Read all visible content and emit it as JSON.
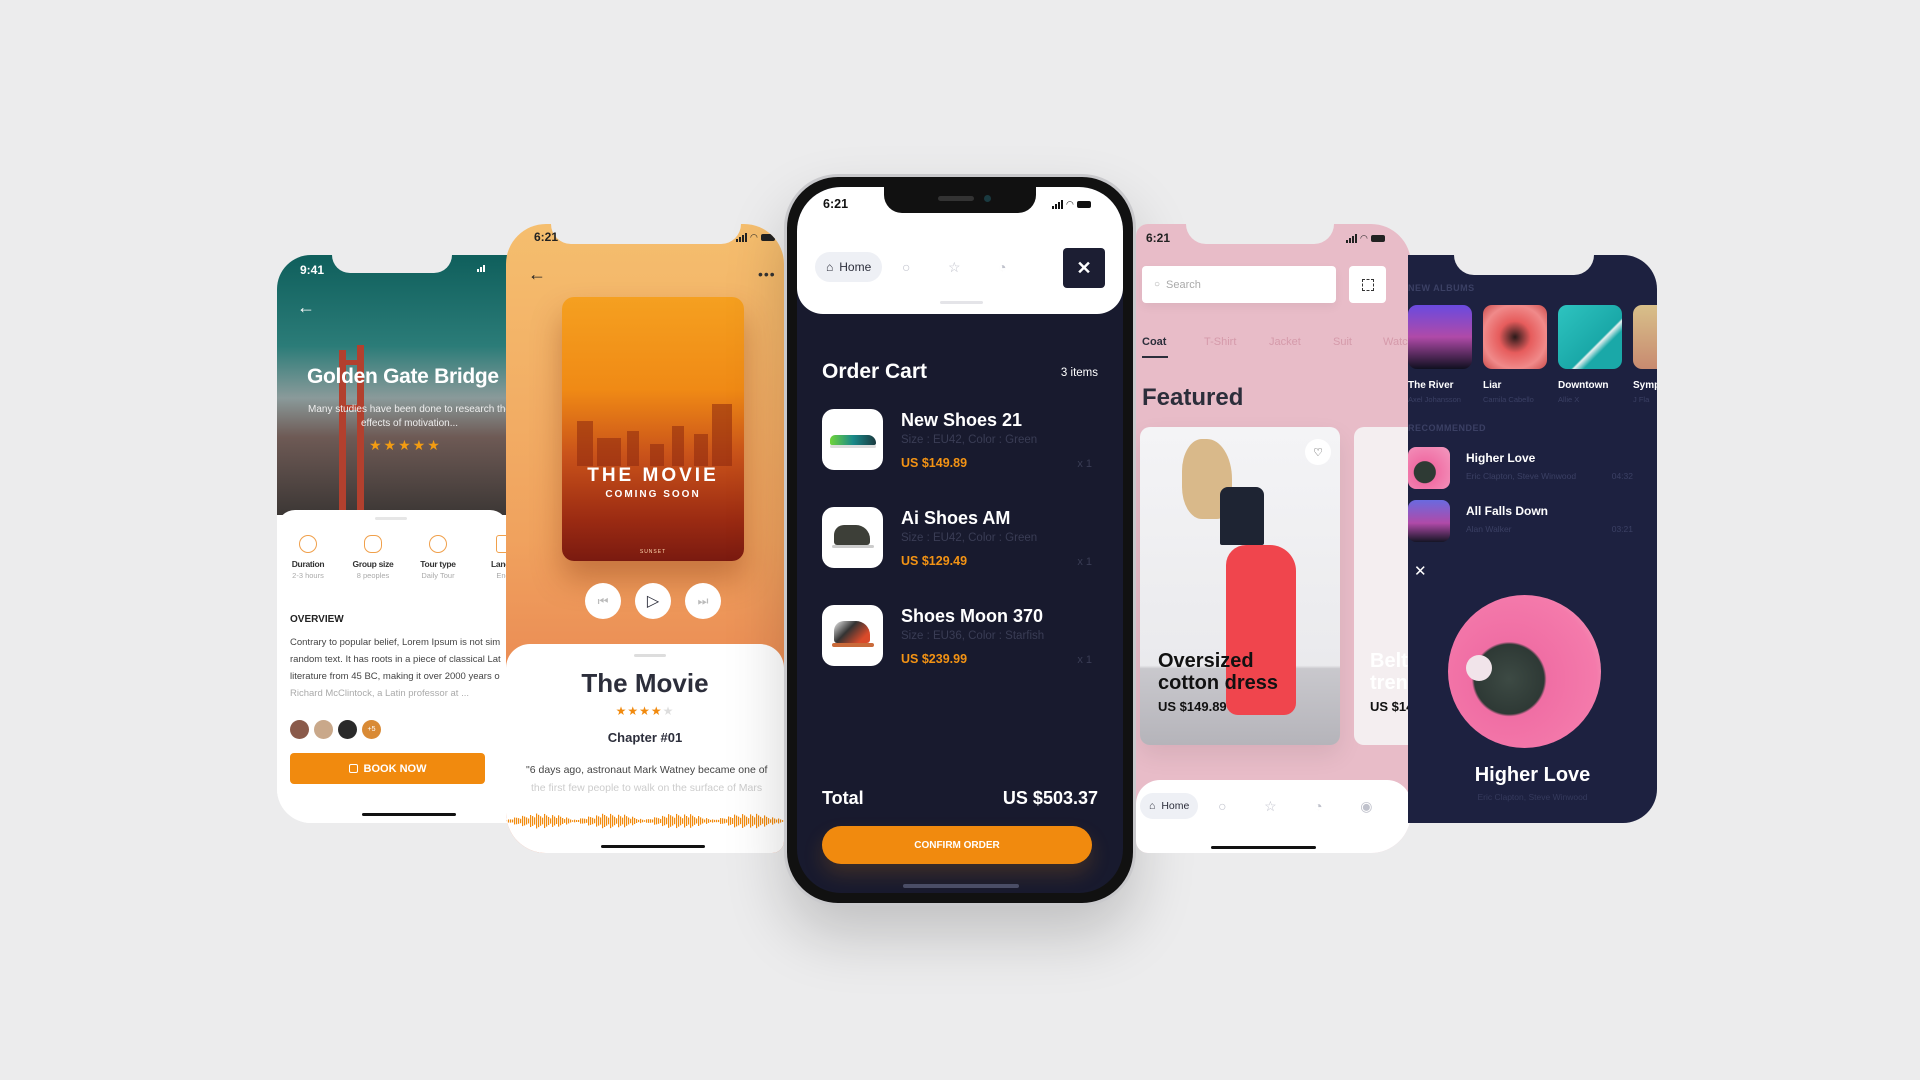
{
  "colors": {
    "background": "#ececed",
    "accent_orange": "#f18a0e",
    "dark_navy": "#181a2e",
    "music_navy": "#1d2140",
    "fashion_pink": "#e8bcc8"
  },
  "tour_app": {
    "status_time": "9:41",
    "back_icon": "arrow-left-icon",
    "title": "Golden Gate Bridge",
    "subtitle": "Many studies have been done to research the effects of motivation...",
    "rating_stars": 5,
    "stars_text": "★★★★★",
    "stats": [
      {
        "icon": "clock-icon",
        "label": "Duration",
        "value": "2-3 hours"
      },
      {
        "icon": "group-icon",
        "label": "Group size",
        "value": "8 peoples"
      },
      {
        "icon": "globe-icon",
        "label": "Tour type",
        "value": "Daily Tour"
      },
      {
        "icon": "language-icon",
        "label": "Langu",
        "value": "Eng"
      }
    ],
    "overview_heading": "OVERVIEW",
    "overview_lines": [
      "Contrary to popular belief, Lorem Ipsum is not sim",
      "random text. It has roots in a piece of classical Lat",
      "literature from 45 BC, making it over 2000 years o",
      "Richard McClintock, a Latin professor at ..."
    ],
    "avatars_extra": "+5",
    "book_button": "BOOK NOW"
  },
  "movie_app": {
    "status_time": "6:21",
    "poster_title": "THE MOVIE",
    "poster_subtitle": "COMING SOON",
    "poster_caption": "SUNSET",
    "controls": {
      "prev": "⏮",
      "play": "▷",
      "next": "⏭"
    },
    "title": "The Movie",
    "rating": 4,
    "rating_max": 5,
    "stars_on": "★★★★",
    "stars_off": "★",
    "chapter": "Chapter #01",
    "quote_line1": "\"6 days ago, astronaut Mark Watney became one of",
    "quote_line2": "the first few people to walk on the surface of Mars"
  },
  "cart_app": {
    "status_time": "6:21",
    "nav": {
      "home_label": "Home",
      "items": [
        "search-icon",
        "star-icon",
        "bell-icon"
      ]
    },
    "close_label": "✕",
    "title": "Order Cart",
    "count": "3 items",
    "items": [
      {
        "name": "New Shoes 21",
        "details": "Size : EU42, Color : Green",
        "price": "US $149.89",
        "qty": "x 1"
      },
      {
        "name": "Ai Shoes AM",
        "details": "Size : EU42, Color : Green",
        "price": "US $129.49",
        "qty": "x 1"
      },
      {
        "name": "Shoes Moon 370",
        "details": "Size : EU36, Color : Starfish",
        "price": "US $239.99",
        "qty": "x 1"
      }
    ],
    "total_label": "Total",
    "total_value": "US $503.37",
    "confirm_button": "CONFIRM ORDER"
  },
  "fashion_app": {
    "status_time": "6:21",
    "search_placeholder": "Search",
    "categories": [
      "Coat",
      "T-Shirt",
      "Jacket",
      "Suit",
      "Watc"
    ],
    "active_category": "Coat",
    "section_title": "Featured",
    "cards": [
      {
        "title_line1": "Oversized",
        "title_line2": "cotton dress",
        "price": "US $149.89"
      },
      {
        "title_line1": "Belt",
        "title_line2": "tren",
        "price": "US $14"
      }
    ],
    "nav": {
      "home_label": "Home"
    }
  },
  "music_app": {
    "new_albums_heading": "NEW ALBUMS",
    "albums": [
      {
        "title": "The River",
        "artist": "Axel Johansson"
      },
      {
        "title": "Liar",
        "artist": "Camila Cabello"
      },
      {
        "title": "Downtown",
        "artist": "Allie X"
      },
      {
        "title": "Symp",
        "artist": "J Fla"
      }
    ],
    "recommended_heading": "RECOMMENDED",
    "songs": [
      {
        "title": "Higher Love",
        "artist": "Eric Clapton, Steve Winwood",
        "duration": "04:32"
      },
      {
        "title": "All Falls Down",
        "artist": "Alan Walker",
        "duration": "03:21"
      }
    ],
    "close_label": "✕",
    "now_playing_title": "Higher Love",
    "now_playing_artist": "Eric Clapton, Steve Winwood"
  }
}
